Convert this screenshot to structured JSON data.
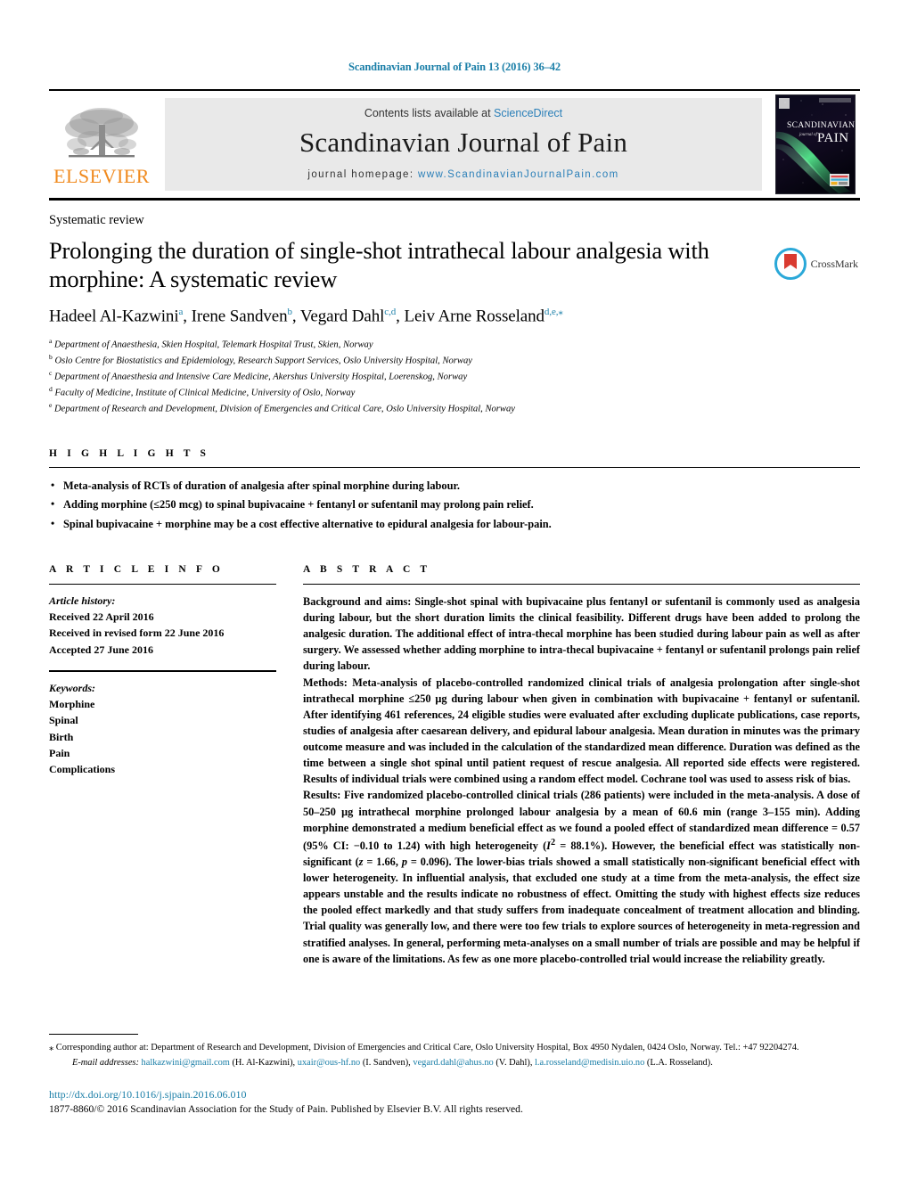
{
  "header": {
    "running_head": "Scandinavian Journal of Pain 13 (2016) 36–42",
    "contents_prefix": "Contents lists available at ",
    "contents_link": "ScienceDirect",
    "journal_name": "Scandinavian Journal of Pain",
    "homepage_prefix": "journal homepage: ",
    "homepage_url": "www.ScandinavianJournalPain.com",
    "publisher_logo_text": "ELSEVIER",
    "cover_title_line1": "SCANDINAVIAN",
    "cover_title_line2": "journal of",
    "cover_title_line3": "PAIN"
  },
  "article": {
    "section_label": "Systematic review",
    "title": "Prolonging the duration of single-shot intrathecal labour analgesia with morphine: A systematic review",
    "crossmark_label": "CrossMark",
    "authors": [
      {
        "name": "Hadeel Al-Kazwini",
        "marks": "a",
        "sep": ", "
      },
      {
        "name": "Irene Sandven",
        "marks": "b",
        "sep": ", "
      },
      {
        "name": "Vegard Dahl",
        "marks": "c,d",
        "sep": ", "
      },
      {
        "name": "Leiv Arne Rosseland",
        "marks": "d,e,⁎",
        "sep": ""
      }
    ],
    "affiliations": [
      {
        "mark": "a",
        "text": "Department of Anaesthesia, Skien Hospital, Telemark Hospital Trust, Skien, Norway"
      },
      {
        "mark": "b",
        "text": "Oslo Centre for Biostatistics and Epidemiology, Research Support Services, Oslo University Hospital, Norway"
      },
      {
        "mark": "c",
        "text": "Department of Anaesthesia and Intensive Care Medicine, Akershus University Hospital, Loerenskog, Norway"
      },
      {
        "mark": "d",
        "text": "Faculty of Medicine, Institute of Clinical Medicine, University of Oslo, Norway"
      },
      {
        "mark": "e",
        "text": "Department of Research and Development, Division of Emergencies and Critical Care, Oslo University Hospital, Norway"
      }
    ]
  },
  "highlights": {
    "heading": "H I G H L I G H T S",
    "items": [
      "Meta-analysis of RCTs of duration of analgesia after spinal morphine during labour.",
      "Adding morphine (≤250 mcg) to spinal bupivacaine + fentanyl or sufentanil may prolong pain relief.",
      "Spinal bupivacaine + morphine may be a cost effective alternative to epidural analgesia for labour-pain."
    ]
  },
  "article_info": {
    "heading": "A R T I C L E    I N F O",
    "history_label": "Article history:",
    "history": [
      "Received 22 April 2016",
      "Received in revised form 22 June 2016",
      "Accepted 27 June 2016"
    ],
    "keywords_label": "Keywords:",
    "keywords": [
      "Morphine",
      "Spinal",
      "Birth",
      "Pain",
      "Complications"
    ]
  },
  "abstract": {
    "heading": "A B S T R A C T",
    "background_label": "Background and aims:",
    "background_text": " Single-shot spinal with bupivacaine plus fentanyl or sufentanil is commonly used as analgesia during labour, but the short duration limits the clinical feasibility. Different drugs have been added to prolong the analgesic duration. The additional effect of intra-thecal morphine has been studied during labour pain as well as after surgery. We assessed whether adding morphine to intra-thecal bupivacaine + fentanyl or sufentanil prolongs pain relief during labour.",
    "methods_label": "Methods:",
    "methods_text": " Meta-analysis of placebo-controlled randomized clinical trials of analgesia prolongation after single-shot intrathecal morphine ≤250 μg during labour when given in combination with bupivacaine + fentanyl or sufentanil. After identifying 461 references, 24 eligible studies were evaluated after excluding duplicate publications, case reports, studies of analgesia after caesarean delivery, and epidural labour analgesia. Mean duration in minutes was the primary outcome measure and was included in the calculation of the standardized mean difference. Duration was defined as the time between a single shot spinal until patient request of rescue analgesia. All reported side effects were registered. Results of individual trials were combined using a random effect model. Cochrane tool was used to assess risk of bias.",
    "results_label": "Results:",
    "results_text_1": " Five randomized placebo-controlled clinical trials (286 patients) were included in the meta-analysis. A dose of 50–250 μg intrathecal morphine prolonged labour analgesia by a mean of 60.6 min (range 3–155 min). Adding morphine demonstrated a medium beneficial effect as we found a pooled effect of standardized mean difference = 0.57 (95% CI: −0.10 to 1.24) with high heterogeneity (",
    "results_i2": "I",
    "results_i2_sup": "2",
    "results_text_2": " = 88.1%). However, the beneficial effect was statistically non-significant (",
    "results_z": "z",
    "results_text_3": " = 1.66, ",
    "results_p": "p",
    "results_text_4": " = 0.096). The lower-bias trials showed a small statistically non-significant beneficial effect with lower heterogeneity. In influential analysis, that excluded one study at a time from the meta-analysis, the effect size appears unstable and the results indicate no robustness of effect. Omitting the study with highest effects size reduces the pooled effect markedly and that study suffers from inadequate concealment of treatment allocation and blinding. Trial quality was generally low, and there were too few trials to explore sources of heterogeneity in meta-regression and stratified analyses. In general, performing meta-analyses on a small number of trials are possible and may be helpful if one is aware of the limitations. As few as one more placebo-controlled trial would increase the reliability greatly."
  },
  "footer": {
    "corresponding_star": "⁎",
    "corresponding_text": " Corresponding author at: Department of Research and Development, Division of Emergencies and Critical Care, Oslo University Hospital, Box 4950 Nydalen, 0424 Oslo, Norway. Tel.: +47 92204274.",
    "emails_label": "E-mail addresses:",
    "emails": [
      {
        "address": "halkazwini@gmail.com",
        "owner": " (H. Al-Kazwini), "
      },
      {
        "address": "uxair@ous-hf.no",
        "owner": " (I. Sandven), "
      },
      {
        "address": "vegard.dahl@ahus.no",
        "owner": " (V. Dahl), "
      },
      {
        "address": "l.a.rosseland@medisin.uio.no",
        "owner": " (L.A. Rosseland)."
      }
    ],
    "doi": "http://dx.doi.org/10.1016/j.sjpain.2016.06.010",
    "copyright": "1877-8860/© 2016 Scandinavian Association for the Study of Pain. Published by Elsevier B.V. All rights reserved."
  },
  "colors": {
    "link": "#1b7fa8",
    "elsevier_orange": "#f08a1e",
    "band_gray": "#e9e9e9"
  }
}
